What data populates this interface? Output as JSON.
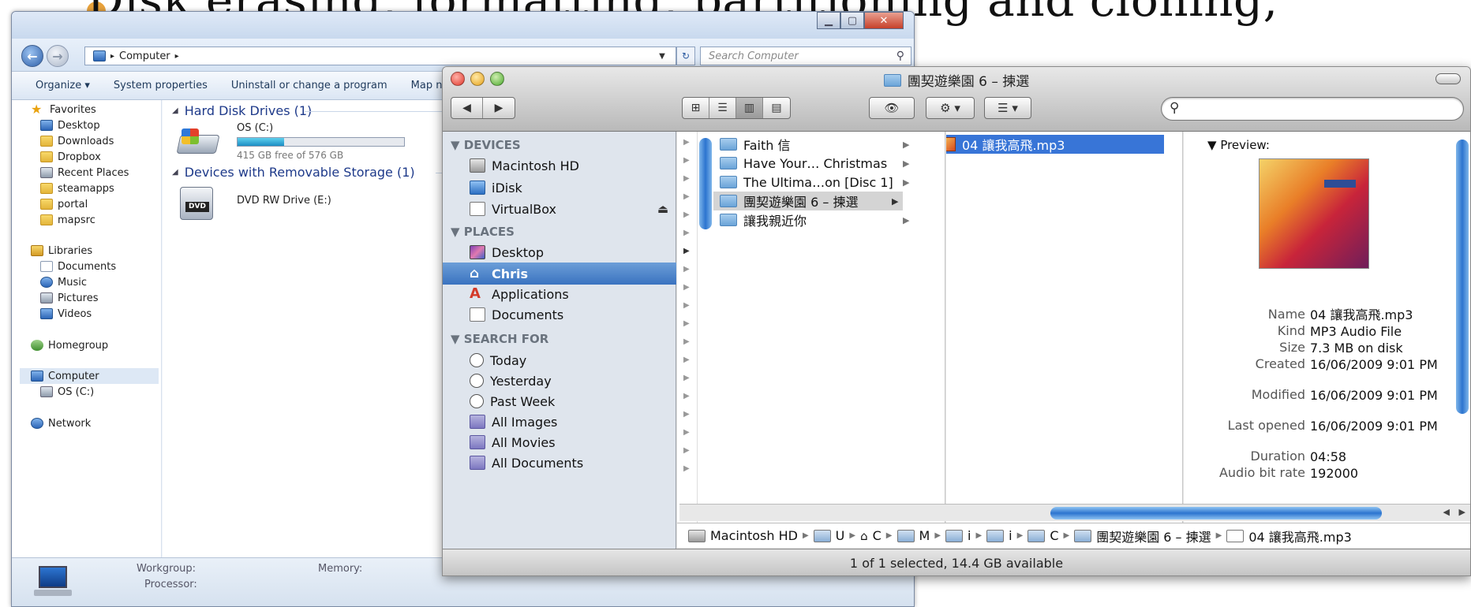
{
  "slide": {
    "headline": "Disk erasing, formatting, partitioning and cloning,"
  },
  "win": {
    "address": [
      "Computer"
    ],
    "search_placeholder": "Search Computer",
    "commands": [
      "Organize ▾",
      "System properties",
      "Uninstall or change a program",
      "Map netw"
    ],
    "nav": {
      "favorites": "Favorites",
      "fav_items": [
        "Desktop",
        "Downloads",
        "Dropbox",
        "Recent Places",
        "steamapps",
        "portal",
        "mapsrc"
      ],
      "libraries": "Libraries",
      "lib_items": [
        "Documents",
        "Music",
        "Pictures",
        "Videos"
      ],
      "homegroup": "Homegroup",
      "computer": "Computer",
      "os_c": "OS (C:)",
      "network": "Network"
    },
    "sections": {
      "hdd": "Hard Disk Drives (1)",
      "removable": "Devices with Removable Storage (1)"
    },
    "drives": {
      "os_name": "OS (C:)",
      "os_free": "415 GB free of 576 GB",
      "os_used_fraction": 0.28,
      "dvd_name": "DVD RW Drive (E:)",
      "dvd_label": "DVD"
    },
    "status": {
      "workgroup": "Workgroup:",
      "memory": "Memory:",
      "processor": "Processor:"
    }
  },
  "mac": {
    "title": "團契遊樂園 6 – 揀選",
    "sidebar": {
      "devices": "DEVICES",
      "device_items": [
        "Macintosh HD",
        "iDisk",
        "VirtualBox"
      ],
      "places": "PLACES",
      "place_items": [
        "Desktop",
        "Chris",
        "Applications",
        "Documents"
      ],
      "search_for": "SEARCH FOR",
      "search_items": [
        "Today",
        "Yesterday",
        "Past Week",
        "All Images",
        "All Movies",
        "All Documents"
      ]
    },
    "column1": [
      "Faith 信",
      "Have Your… Christmas",
      "The Ultima…on [Disc 1]",
      "團契遊樂園 6 – 揀選",
      "讓我親近你"
    ],
    "column2": [
      "04 讓我高飛.mp3"
    ],
    "preview": {
      "header": "Preview:",
      "meta": [
        {
          "k": "Name",
          "v": "04 讓我高飛.mp3"
        },
        {
          "k": "Kind",
          "v": "MP3 Audio File"
        },
        {
          "k": "Size",
          "v": "7.3 MB on disk"
        },
        {
          "k": "Created",
          "v": "16/06/2009 9:01 PM"
        },
        {
          "k": "Modified",
          "v": "16/06/2009 9:01 PM"
        },
        {
          "k": "Last opened",
          "v": "16/06/2009 9:01 PM"
        },
        {
          "k": "Duration",
          "v": "04:58"
        },
        {
          "k": "Audio bit rate",
          "v": "192000"
        }
      ]
    },
    "path": [
      "Macintosh HD",
      "U",
      "C",
      "M",
      "i",
      "i",
      "C",
      "團契遊樂園 6 – 揀選",
      "04 讓我高飛.mp3"
    ],
    "status": "1 of 1 selected, 14.4 GB available"
  }
}
